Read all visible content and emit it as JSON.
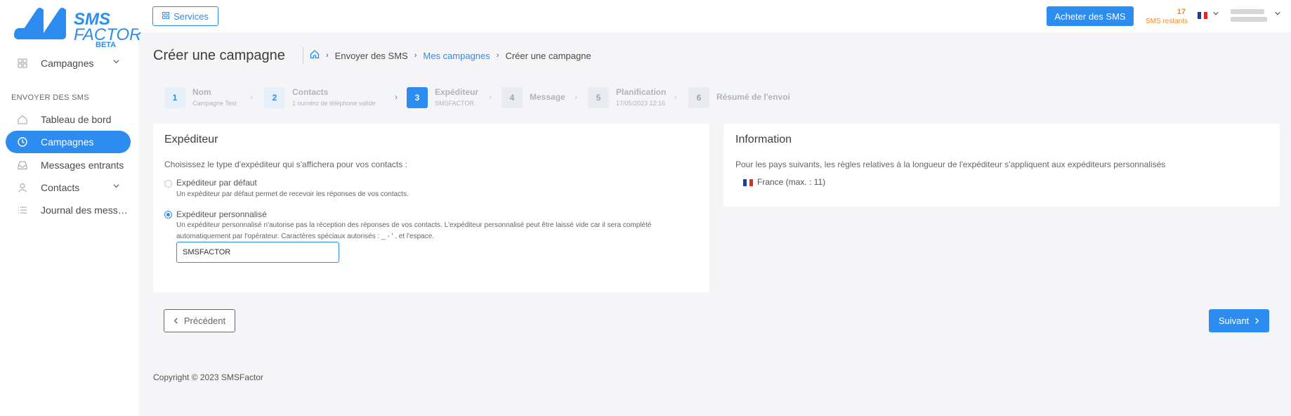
{
  "brand": {
    "line1": "SMS",
    "line2": "FACTOR",
    "tag": "BETA",
    "color": "#2d8cf0"
  },
  "sidebar": {
    "top_item": {
      "label": "Campagnes",
      "icon": "grid-icon"
    },
    "section_label": "ENVOYER DES SMS",
    "items": [
      {
        "label": "Tableau de bord",
        "icon": "home-icon"
      },
      {
        "label": "Campagnes",
        "icon": "clock-icon",
        "active": true
      },
      {
        "label": "Messages entrants",
        "icon": "inbox-icon"
      },
      {
        "label": "Contacts",
        "icon": "user-icon"
      },
      {
        "label": "Journal des mess…",
        "icon": "list-icon"
      }
    ]
  },
  "header": {
    "services_label": "Services",
    "buy_label": "Acheter des SMS",
    "credits": "17",
    "credits_label": "SMS restants",
    "language_flag": "fr-flag-icon"
  },
  "page": {
    "title": "Créer une campagne",
    "breadcrumb": {
      "level1": "Envoyer des SMS",
      "level2": "Mes campagnes",
      "level3": "Créer une campagne"
    }
  },
  "steps": [
    {
      "num": "1",
      "title": "Nom",
      "sub": "Campagne Test",
      "state": "done"
    },
    {
      "num": "2",
      "title": "Contacts",
      "sub": "1 numéro de téléphone valide",
      "state": "done"
    },
    {
      "num": "3",
      "title": "Expéditeur",
      "sub": "SMSFACTOR",
      "state": "current"
    },
    {
      "num": "4",
      "title": "Message",
      "sub": "",
      "state": "todo"
    },
    {
      "num": "5",
      "title": "Planification",
      "sub": "17/05/2023 12:16",
      "state": "todo"
    },
    {
      "num": "6",
      "title": "Résumé de l'envoi",
      "sub": "",
      "state": "todo"
    }
  ],
  "sender_card": {
    "title": "Expéditeur",
    "prompt": "Choisissez le type d'expéditeur qui s'affichera pour vos contacts :",
    "option_default": {
      "label": "Expéditeur par défaut",
      "description": "Un expéditeur par défaut permet de recevoir les réponses de vos contacts.",
      "checked": false
    },
    "option_custom": {
      "label": "Expéditeur personnalisé",
      "description_line1": "Un expéditeur personnalisé n'autorise pas la réception des réponses de vos contacts. L'expéditeur personnalisé peut être laissé vide car il sera complété",
      "description_line2": "automatiquement par l'opérateur. Caractères spéciaux autorisés : _ - ' . et l'espace.",
      "checked": true
    },
    "input_value": "SMSFACTOR"
  },
  "info_card": {
    "title": "Information",
    "text": "Pour les pays suivants, les règles relatives à la longueur de l'expéditeur s'appliquent aux expéditeurs personnalisés",
    "country": "France (max. : 11)"
  },
  "actions": {
    "prev_label": "Précédent",
    "next_label": "Suivant"
  },
  "footer": {
    "copyright": "Copyright © 2023 SMSFactor"
  }
}
